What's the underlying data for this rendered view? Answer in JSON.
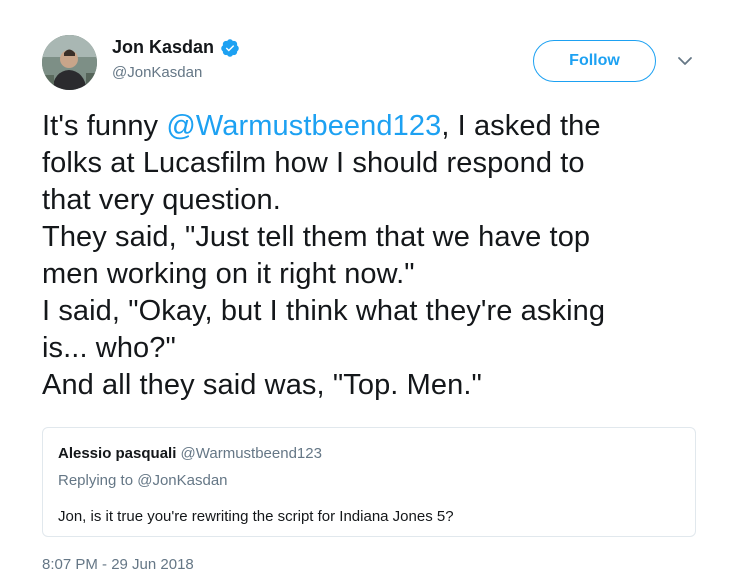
{
  "author": {
    "name": "Jon Kasdan",
    "handle": "@JonKasdan",
    "verified": true,
    "follow_label": "Follow"
  },
  "tweet": {
    "lines": [
      {
        "pre": "It's funny ",
        "mention": "@Warmustbeend123",
        "post": ", I asked the"
      },
      "folks at Lucasfilm how I should respond to",
      "that very question.",
      "They said, \"Just tell them that we have top",
      "men working on it right now.\"",
      "I said, \"Okay, but I think what they're asking",
      "is... who?\"",
      "And all they said was, \"Top. Men.\""
    ]
  },
  "quoted_tweet": {
    "name": "Alessio pasquali",
    "handle": "@Warmustbeend123",
    "replying_to": "Replying to @JonKasdan",
    "text": "Jon, is it true you're rewriting the script for Indiana Jones 5?"
  },
  "timestamp": "8:07 PM - 29 Jun 2018",
  "colors": {
    "accent": "#1da1f2",
    "text": "#14171a",
    "secondary": "#657786",
    "border": "#e1e8ed"
  },
  "icons": {
    "verified": "verified-badge-icon",
    "caret": "chevron-down-icon"
  }
}
